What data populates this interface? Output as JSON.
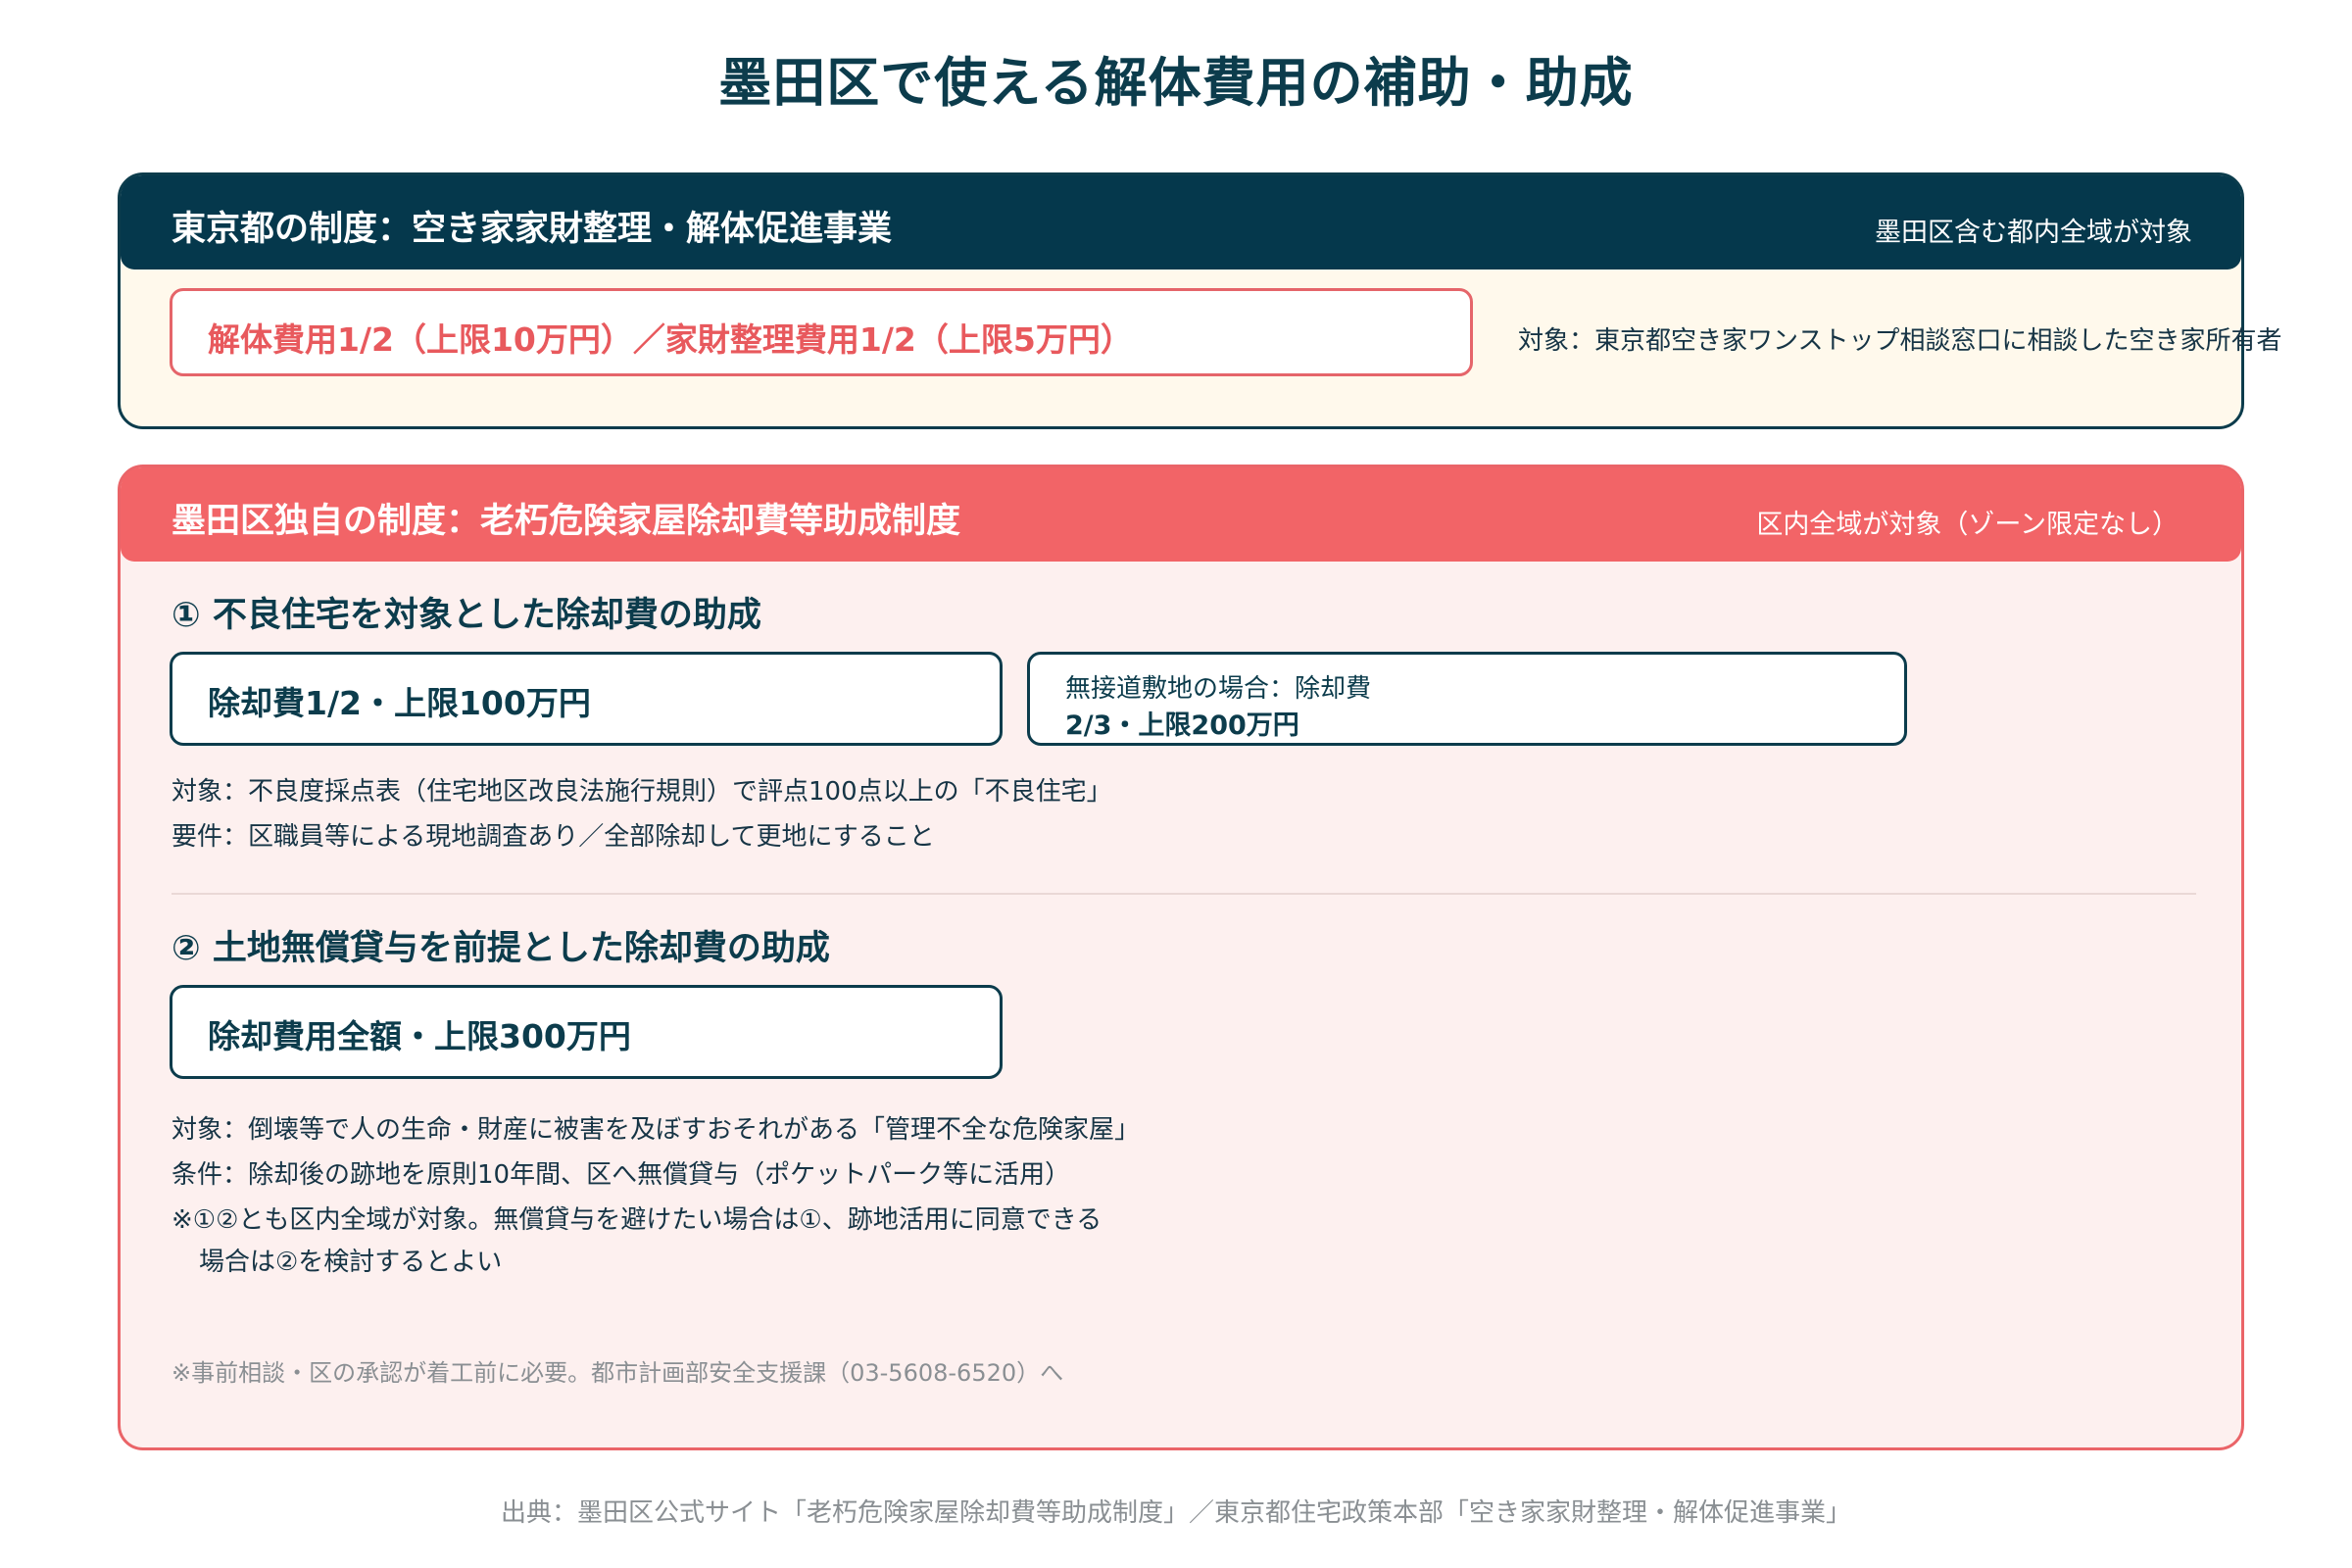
{
  "title": "墨田区で使える解体費用の補助・助成",
  "tokyo": {
    "header_title": "東京都の制度：空き家家財整理・解体促進事業",
    "header_note": "墨田区含む都内全域が対象",
    "subsidy": "解体費用1/2（上限10万円）／家財整理費用1/2（上限5万円）",
    "target": "対象：東京都空き家ワンストップ相談窓口に相談した空き家所有者"
  },
  "sumida": {
    "header_title": "墨田区独自の制度：老朽危険家屋除却費等助成制度",
    "header_note": "区内全域が対象（ゾーン限定なし）",
    "section1": {
      "title": "① 不良住宅を対象とした除却費の助成",
      "box1": "除却費1/2・上限100万円",
      "box2_line1": "無接道敷地の場合：除却費",
      "box2_line2": "2/3・上限200万円",
      "target": "対象：不良度採点表（住宅地区改良法施行規則）で評点100点以上の「不良住宅」",
      "requirement": "要件：区職員等による現地調査あり／全部除却して更地にすること"
    },
    "section2": {
      "title": "② 土地無償貸与を前提とした除却費の助成",
      "box1": "除却費用全額・上限300万円",
      "target": "対象：倒壊等で人の生命・財産に被害を及ぼすおそれがある「管理不全な危険家屋」",
      "condition": "条件：除却後の跡地を原則10年間、区へ無償貸与（ポケットパーク等に活用）",
      "note_line1": "※①②とも区内全域が対象。無償貸与を避けたい場合は①、跡地活用に同意できる",
      "note_line2": "場合は②を検討するとよい"
    },
    "footnote": "※事前相談・区の承認が着工前に必要。都市計画部安全支援課（03-5608-6520）へ"
  },
  "source": "出典：墨田区公式サイト「老朽危険家屋除却費等助成制度」／東京都住宅政策本部「空き家家財整理・解体促進事業」"
}
